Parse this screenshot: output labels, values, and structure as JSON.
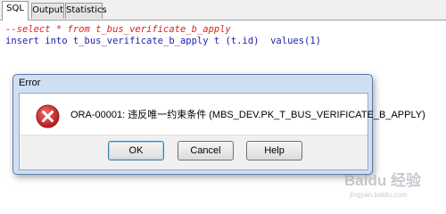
{
  "tabs": [
    {
      "label": "SQL",
      "active": true
    },
    {
      "label": "Output",
      "active": false
    },
    {
      "label": "Statistics",
      "active": false
    }
  ],
  "editor": {
    "line1": "--select * from t_bus_verificate_b_apply",
    "line2": "insert into t_bus_verificate_b_apply t (t.id)  values(1)"
  },
  "dialog": {
    "title": "Error",
    "icon": "error-icon",
    "message": "ORA-00001: 违反唯一约束条件 (MBS_DEV.PK_T_BUS_VERIFICATE_B_APPLY)",
    "buttons": {
      "ok": "OK",
      "cancel": "Cancel",
      "help": "Help"
    }
  },
  "watermark": {
    "text": "Baidu 经验",
    "subtext": "jingyan.baidu.com"
  },
  "colors": {
    "comment": "#e02020",
    "keyword": "#2020b0",
    "dialog_frame": "#cfdff2",
    "error_icon": "#c62828"
  }
}
